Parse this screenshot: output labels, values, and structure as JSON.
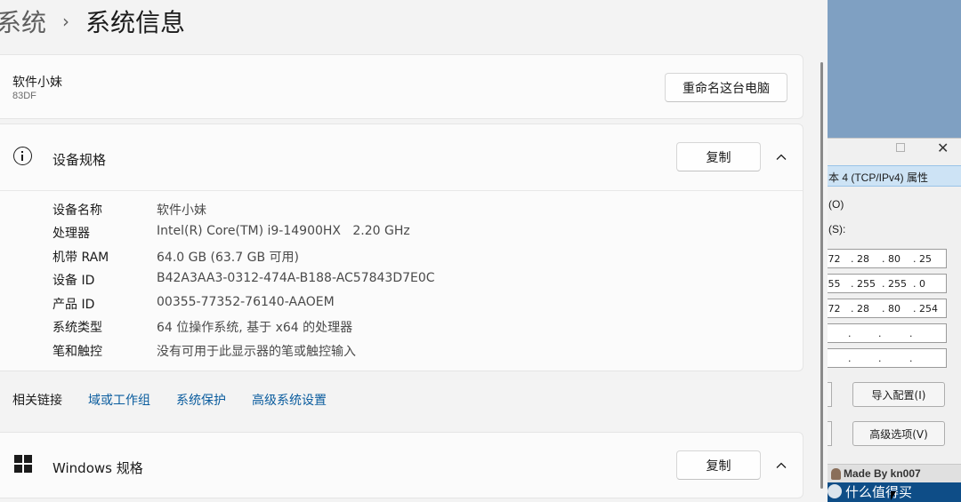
{
  "breadcrumb": {
    "parent": "系统",
    "separator": "›",
    "current": "系统信息"
  },
  "device": {
    "name": "软件小妹",
    "model": "83DF",
    "rename_button": "重命名这台电脑"
  },
  "device_specs": {
    "title": "设备规格",
    "copy_button": "复制",
    "rows": [
      {
        "label": "设备名称",
        "value": "软件小妹"
      },
      {
        "label": "处理器",
        "value": "Intel(R) Core(TM) i9-14900HX   2.20 GHz"
      },
      {
        "label": "机带 RAM",
        "value": "64.0 GB (63.7 GB 可用)"
      },
      {
        "label": "设备 ID",
        "value": "B42A3AA3-0312-474A-B188-AC57843D7E0C"
      },
      {
        "label": "产品 ID",
        "value": "00355-77352-76140-AAOEM"
      },
      {
        "label": "系统类型",
        "value": "64 位操作系统, 基于 x64 的处理器"
      },
      {
        "label": "笔和触控",
        "value": "没有可用于此显示器的笔或触控输入"
      }
    ]
  },
  "related_links": {
    "label": "相关链接",
    "links": [
      "域或工作组",
      "系统保护",
      "高级系统设置"
    ]
  },
  "windows_specs": {
    "title": "Windows 规格",
    "copy_button": "复制"
  },
  "dialog": {
    "title": "本 4 (TCP/IPv4) 属性",
    "option1": "(O)",
    "option2": "(S):",
    "ip_fields": [
      [
        ".72",
        ". 28",
        ". 80",
        ". 25"
      ],
      [
        ".55",
        ". 255",
        ". 255",
        ". 0"
      ],
      [
        ".72",
        ". 28",
        ". 80",
        ". 254"
      ],
      [
        ".",
        ".",
        ".",
        ""
      ],
      [
        ".",
        ".",
        ".",
        ""
      ]
    ],
    "import_button": "导入配置(I)",
    "advanced_button": "高级选项(V)",
    "footer": "Made By kn007",
    "close_glyph": "✕"
  },
  "watermark": "什么值得买"
}
